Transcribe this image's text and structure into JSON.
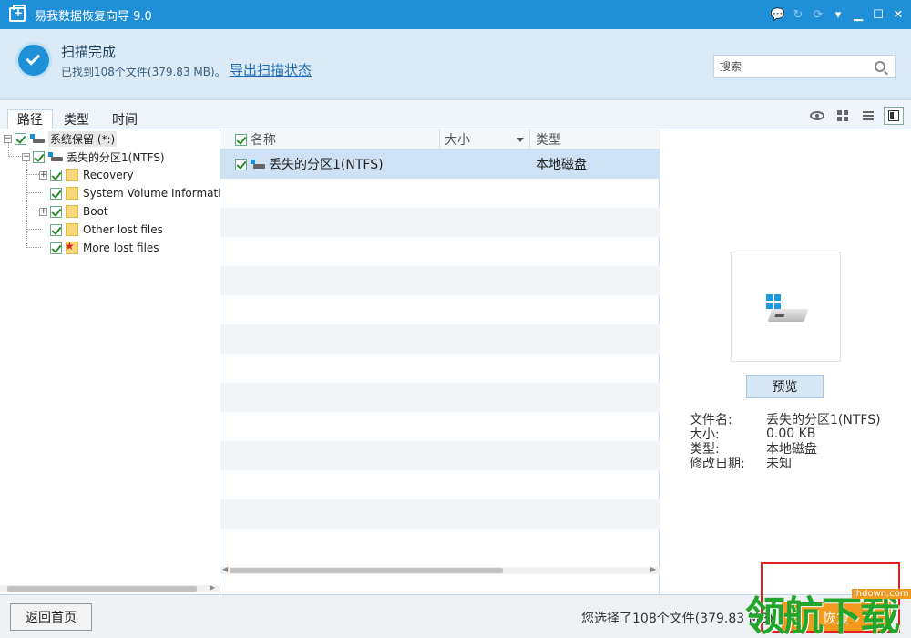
{
  "app": {
    "title": "易我数据恢复向导 9.0"
  },
  "header": {
    "scan_title": "扫描完成",
    "scan_subtitle": "已找到108个文件(379.83 MB)。",
    "export_link": "导出扫描状态",
    "search_placeholder": "搜索"
  },
  "tabs": [
    {
      "label": "路径",
      "active": true
    },
    {
      "label": "类型",
      "active": false
    },
    {
      "label": "时间",
      "active": false
    }
  ],
  "tree": {
    "root": "系统保留 (*:)",
    "partition": "丢失的分区1(NTFS)",
    "folders": [
      "Recovery",
      "System Volume Informati",
      "Boot",
      "Other lost files",
      "More lost files"
    ]
  },
  "list": {
    "columns": [
      "名称",
      "大小",
      "类型"
    ],
    "rows": [
      {
        "name": "丢失的分区1(NTFS)",
        "size": "",
        "type": "本地磁盘",
        "selected": true
      }
    ]
  },
  "preview": {
    "button": "预览",
    "props": [
      {
        "key": "文件名:",
        "value": "丢失的分区1(NTFS)"
      },
      {
        "key": "大小:",
        "value": "0.00 KB"
      },
      {
        "key": "类型:",
        "value": "本地磁盘"
      },
      {
        "key": "修改日期:",
        "value": "未知"
      }
    ]
  },
  "footer": {
    "home_button": "返回首页",
    "status": "您选择了108个文件(379.83 MB)",
    "recover_button": "恢复"
  },
  "watermark": {
    "text": "领航下载",
    "url": "lhdown.com"
  },
  "colors": {
    "titlebar": "#1f8fd8",
    "accent": "#f29a1e",
    "header_bg": "#dbeaf7"
  }
}
